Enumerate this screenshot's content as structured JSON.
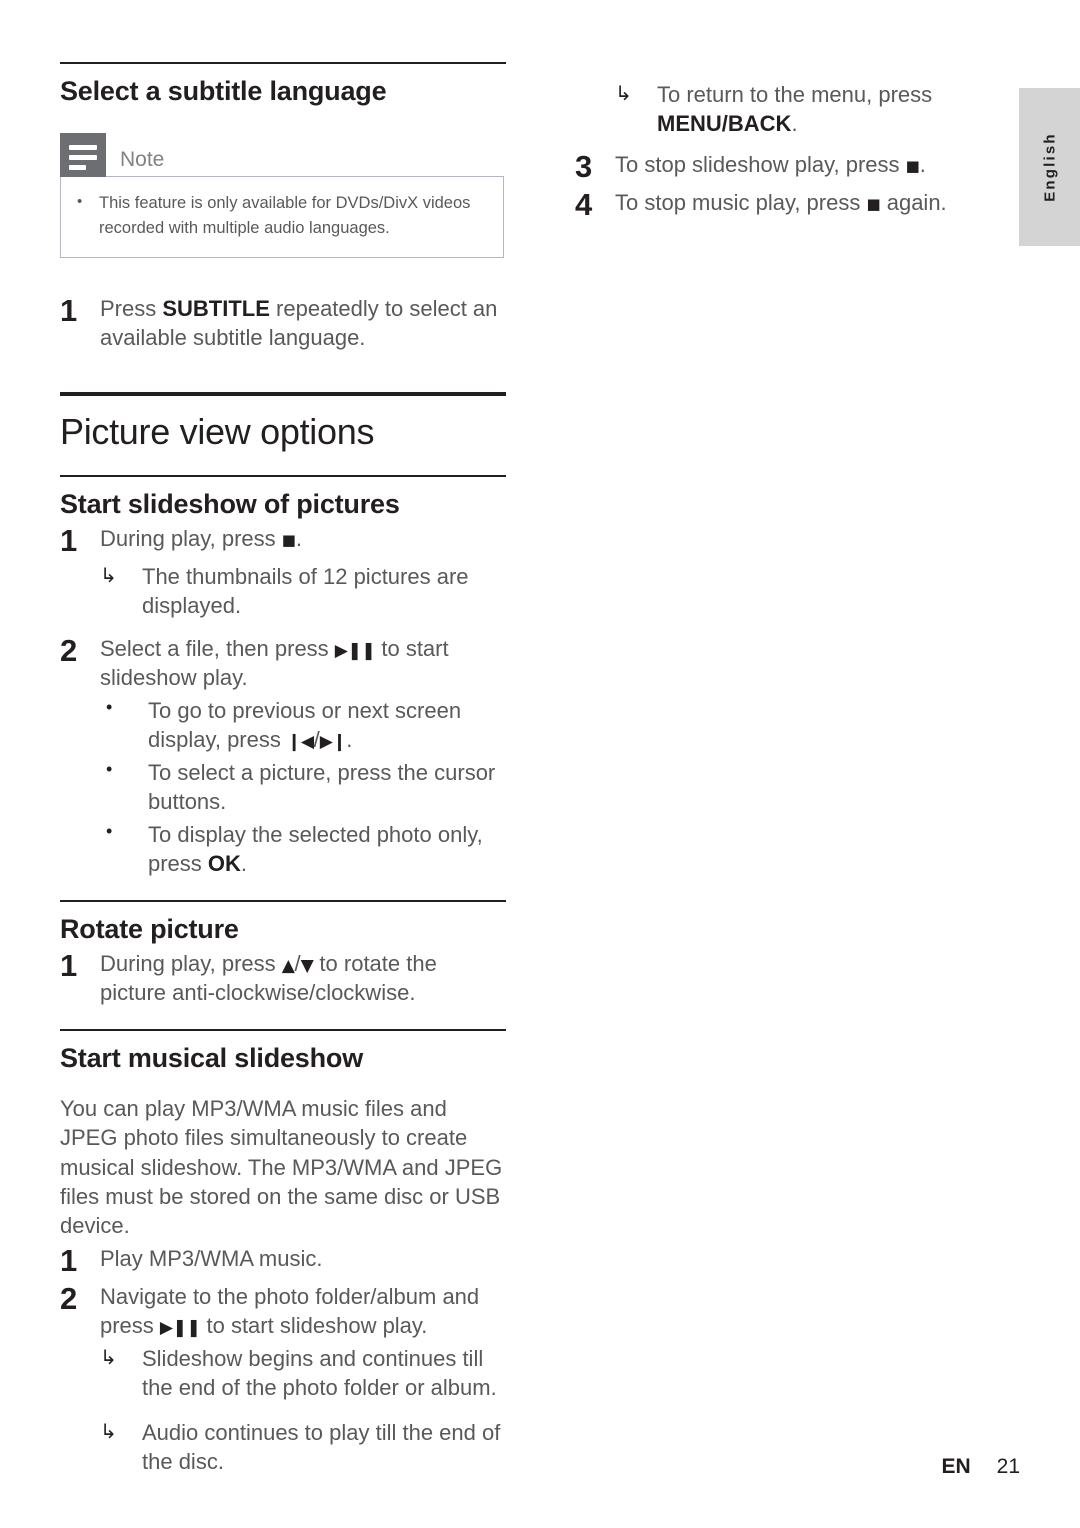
{
  "language_tab": {
    "label": "English"
  },
  "footer": {
    "language_code": "EN",
    "page_number": "21"
  },
  "left_column": {
    "section_subtitle": {
      "heading": "Select a subtitle language",
      "note": {
        "title": "Note",
        "items": [
          "This feature is only available for DVDs/DivX videos recorded with multiple audio languages."
        ]
      },
      "steps": [
        {
          "number": "1",
          "text_before": "Press ",
          "bold": "SUBTITLE",
          "text_after": " repeatedly to select an available subtitle language."
        }
      ]
    },
    "section_picture_view": {
      "heading": "Picture view options",
      "sub_slideshow": {
        "heading": "Start slideshow of pictures",
        "step1": {
          "number": "1",
          "text_before": "During play, press ",
          "glyph": "stop-square",
          "text_after": ".",
          "arrows": [
            "The thumbnails of 12 pictures are displayed."
          ]
        },
        "step2": {
          "number": "2",
          "text_before": "Select a file, then press ",
          "glyph": "play-pause",
          "text_after": " to start slideshow play.",
          "bullets": [
            {
              "text_before": "To go to previous or next screen display, press ",
              "glyph_prev": "previous-track",
              "glyph_sep": "/",
              "glyph_next": "next-track",
              "text_after": "."
            },
            {
              "text": "To select a picture, press the cursor buttons."
            },
            {
              "text_before": "To display the selected photo only, press ",
              "bold": "OK",
              "text_after": "."
            }
          ]
        }
      },
      "sub_rotate": {
        "heading": "Rotate picture",
        "step1": {
          "number": "1",
          "text_before": "During play, press ",
          "glyph_up": "arrow-up",
          "glyph_sep": "/",
          "glyph_down": "arrow-down",
          "text_after": " to rotate the picture anti-clockwise/clockwise."
        }
      },
      "sub_musical": {
        "heading": "Start musical slideshow",
        "paragraph": "You can play MP3/WMA music files and JPEG photo files simultaneously to create musical slideshow. The MP3/WMA and JPEG files must be stored on the same disc or USB device.",
        "step1": {
          "number": "1",
          "text": "Play MP3/WMA music."
        },
        "step2": {
          "number": "2",
          "text_before": "Navigate to the photo folder/album and press ",
          "glyph": "play-pause",
          "text_after": " to start slideshow play.",
          "arrows": [
            "Slideshow begins and continues till the end of the photo folder or album.",
            "Audio continues to play till the end of the disc."
          ]
        }
      }
    }
  },
  "right_column": {
    "continued_arrow": {
      "text_before": "To return to the menu, press ",
      "bold": "MENU/BACK",
      "text_after": "."
    },
    "steps": [
      {
        "number": "3",
        "text_before": "To stop slideshow play, press ",
        "glyph": "stop-square",
        "text_after": "."
      },
      {
        "number": "4",
        "text_before": "To stop music play, press ",
        "glyph": "stop-square",
        "text_after": " again."
      }
    ]
  },
  "glyphs": {
    "stop-square": "■",
    "play-pause": "▶❚❚",
    "previous-track": "❙◀",
    "next-track": "▶❙",
    "arrow-up": "▲",
    "arrow-down": "▼",
    "sub-arrow": "↳"
  },
  "colors": {
    "text_body": "#58595b",
    "text_heading": "#231f20",
    "note_icon_bg": "#6d6e71",
    "note_border": "#b3b6c6",
    "lang_tab_bg": "#d4d4d4"
  }
}
